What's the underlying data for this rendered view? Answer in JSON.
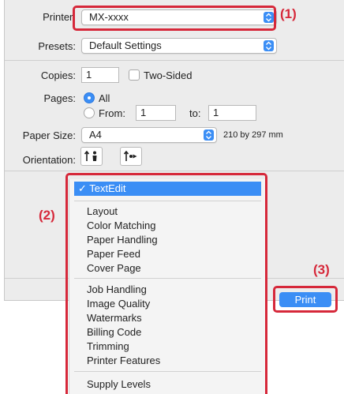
{
  "printer": {
    "label": "Printer:",
    "value": "MX-xxxx"
  },
  "presets": {
    "label": "Presets:",
    "value": "Default Settings"
  },
  "copies": {
    "label": "Copies:",
    "value": "1",
    "two_sided_label": "Two-Sided"
  },
  "pages": {
    "label": "Pages:",
    "all_label": "All",
    "from_label": "From:",
    "from_value": "1",
    "to_label": "to:",
    "to_value": "1"
  },
  "paper": {
    "label": "Paper Size:",
    "value": "A4",
    "dims": "210 by 297 mm"
  },
  "orientation": {
    "label": "Orientation:"
  },
  "menu": {
    "selected": "✓ TextEdit",
    "group1": [
      "Layout",
      "Color Matching",
      "Paper Handling",
      "Paper Feed",
      "Cover Page"
    ],
    "group2": [
      "Job Handling",
      "Image Quality",
      "Watermarks",
      "Billing Code",
      "Trimming",
      "Printer Features"
    ],
    "group3": [
      "Supply Levels"
    ]
  },
  "print_button": "Print",
  "callouts": [
    "(1)",
    "(2)",
    "(3)"
  ],
  "colors": {
    "accent": "#3b8ef5",
    "callout": "#d6283a"
  }
}
